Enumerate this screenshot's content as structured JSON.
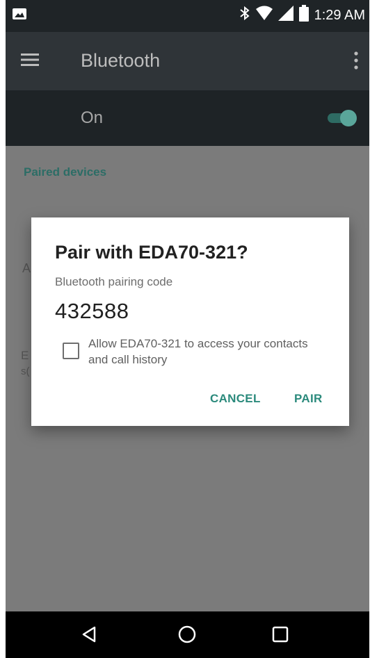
{
  "status_bar": {
    "time": "1:29 AM",
    "icons": [
      "image-icon",
      "bluetooth-icon",
      "wifi-icon",
      "signal-icon",
      "battery-icon"
    ]
  },
  "app_bar": {
    "title": "Bluetooth",
    "icons": [
      "menu-icon",
      "more-vert-icon"
    ]
  },
  "switch_bar": {
    "label": "On",
    "state": "on"
  },
  "content": {
    "section_title": "Paired devices",
    "partial_texts": [
      "A",
      "E",
      "s("
    ]
  },
  "dialog": {
    "title": "Pair with EDA70-321?",
    "subtitle": "Bluetooth pairing code",
    "code": "432588",
    "checkbox_label": "Allow EDA70-321 to access your contacts and call history",
    "checkbox_checked": false,
    "cancel_label": "CANCEL",
    "pair_label": "PAIR"
  },
  "nav_bar": {
    "icons": [
      "back-icon",
      "home-icon",
      "recents-icon"
    ]
  },
  "colors": {
    "accent": "#2b8a7c",
    "status_bar": "#1f2427",
    "app_bar": "#2f3438",
    "switch_bar": "#1e2326",
    "scrim_content": "#7b7b7b"
  }
}
